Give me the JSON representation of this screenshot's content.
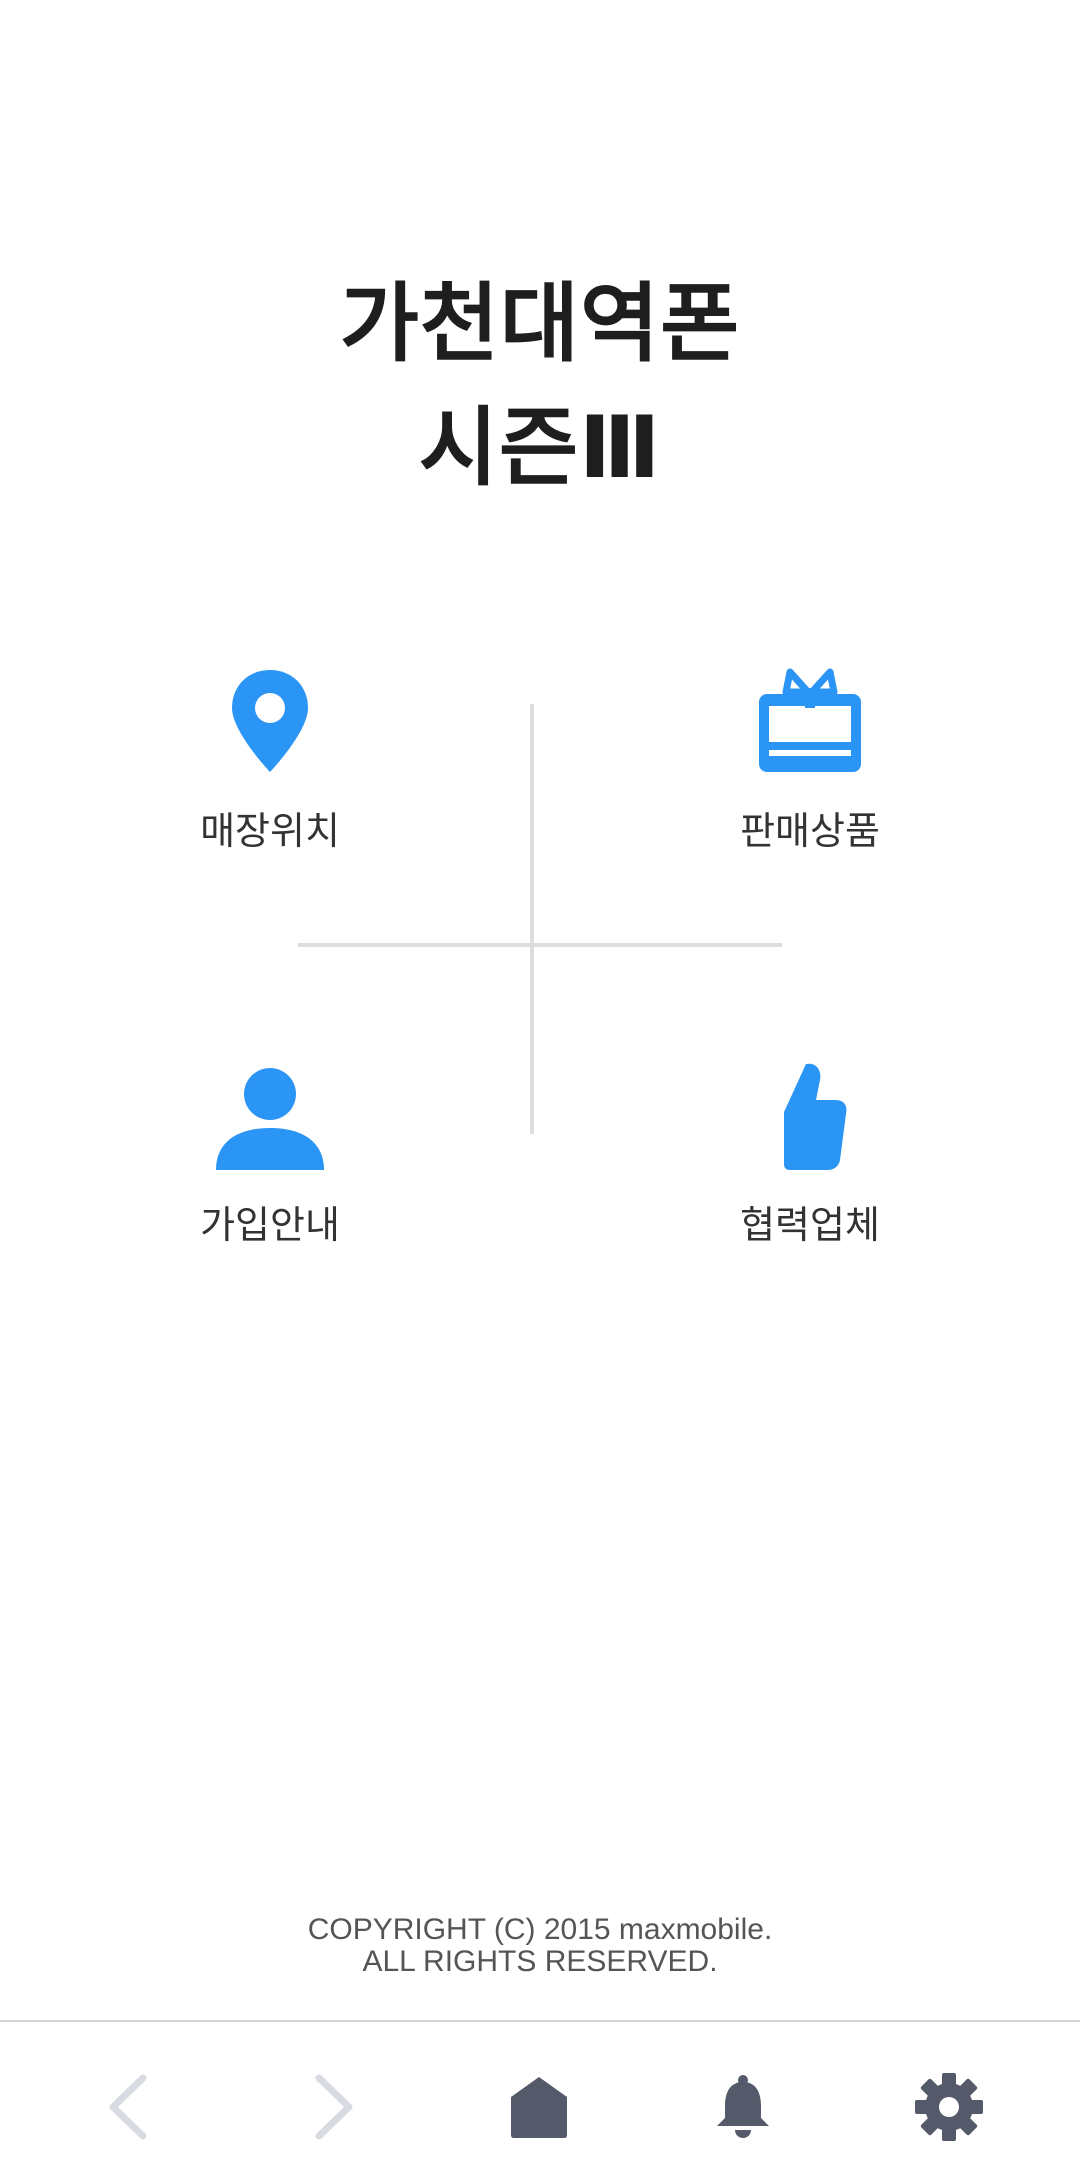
{
  "title": {
    "line1": "가천대역폰",
    "line2": "시즌Ⅲ"
  },
  "menu": [
    {
      "label": "매장위치",
      "icon": "location-pin-icon"
    },
    {
      "label": "판매상품",
      "icon": "gift-box-icon"
    },
    {
      "label": "가입안내",
      "icon": "person-icon"
    },
    {
      "label": "협력업체",
      "icon": "thumbs-up-icon"
    }
  ],
  "footer": {
    "copyright_line1": "COPYRIGHT (C) 2015 maxmobile.",
    "copyright_line2": "ALL RIGHTS RESERVED."
  },
  "bottom_nav": [
    {
      "icon": "chevron-left-icon"
    },
    {
      "icon": "chevron-right-icon"
    },
    {
      "icon": "home-icon"
    },
    {
      "icon": "bell-icon"
    },
    {
      "icon": "gear-icon"
    }
  ],
  "colors": {
    "accent": "#2b95f5",
    "nav_icon": "#555a6a",
    "nav_icon_disabled": "#d8dbe1",
    "divider": "#dddddd"
  }
}
